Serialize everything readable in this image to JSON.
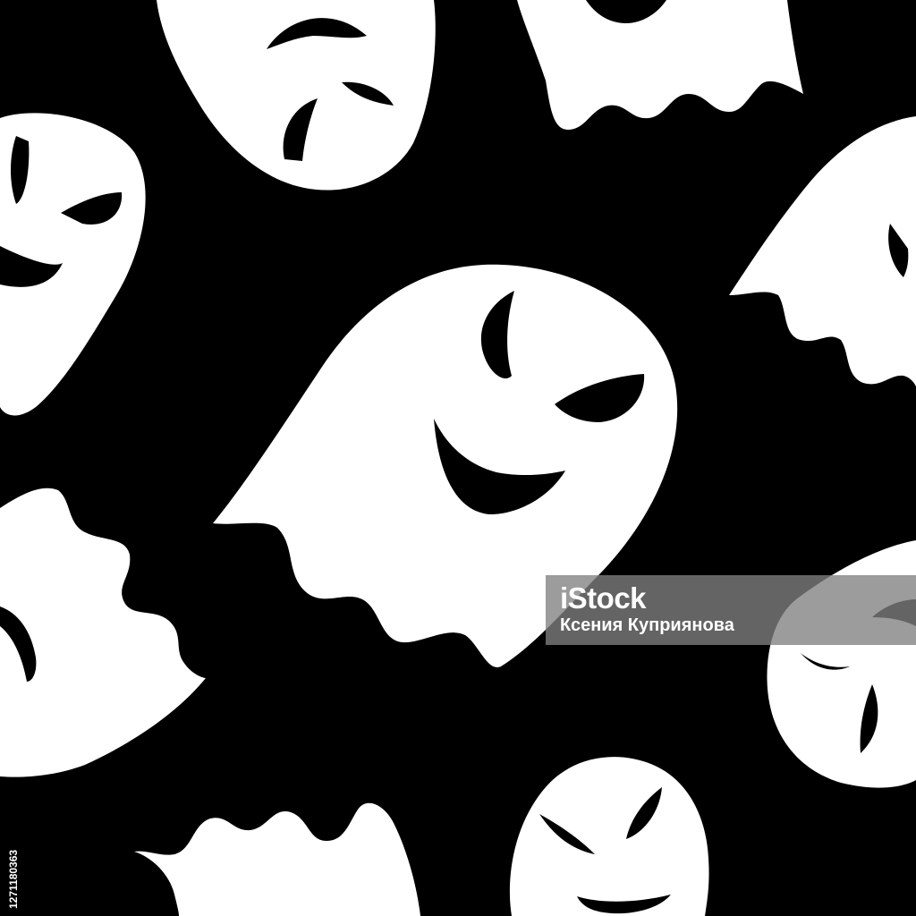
{
  "watermark": {
    "logo": "iStock",
    "credit": "Ксения Куприянова",
    "image_id": "1271180363"
  },
  "colors": {
    "background": "#000000",
    "ghost": "#ffffff",
    "watermark_box": "#808080"
  }
}
